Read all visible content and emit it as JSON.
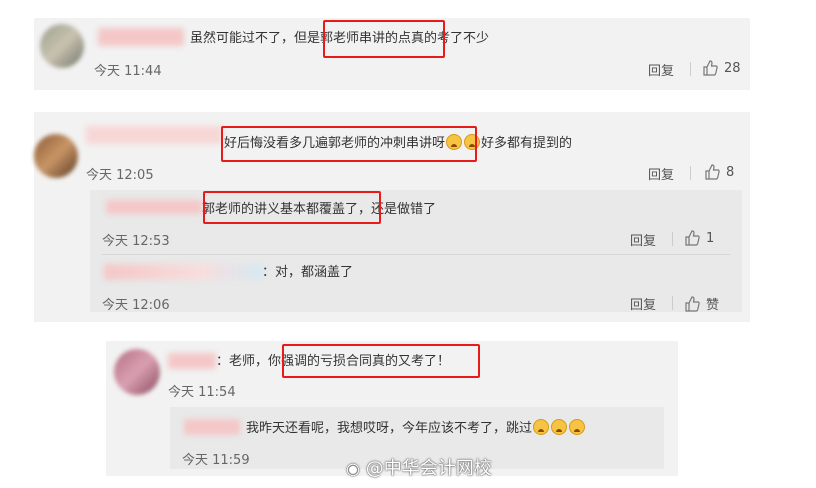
{
  "comments": [
    {
      "text": "虽然可能过不了，但是郭老师串讲的点真的考了不少",
      "time": "今天 11:44",
      "reply_label": "回复",
      "like_count": "28"
    },
    {
      "text_before": "好后悔没看多几遍郭老师的冲刺串讲呀",
      "text_after": "好多都有提到的",
      "time": "今天 12:05",
      "reply_label": "回复",
      "like_count": "8",
      "replies": [
        {
          "text": "郭老师的讲义基本都覆盖了，还是做错了",
          "time": "今天 12:53",
          "reply_label": "回复",
          "like_count": "1"
        },
        {
          "text": "：对，都涵盖了",
          "time": "今天 12:06",
          "reply_label": "回复",
          "like_count": "赞"
        }
      ]
    },
    {
      "text": "：老师，你强调的亏损合同真的又考了！",
      "time": "今天 11:54",
      "replies": [
        {
          "text": "我昨天还看呢，我想哎呀，今年应该不考了，跳过",
          "time": "今天 11:59"
        }
      ]
    }
  ],
  "watermark": "@中华会计网校",
  "colors": {
    "highlight_box": "#e81a1a",
    "card_bg": "#f2f2f2"
  }
}
